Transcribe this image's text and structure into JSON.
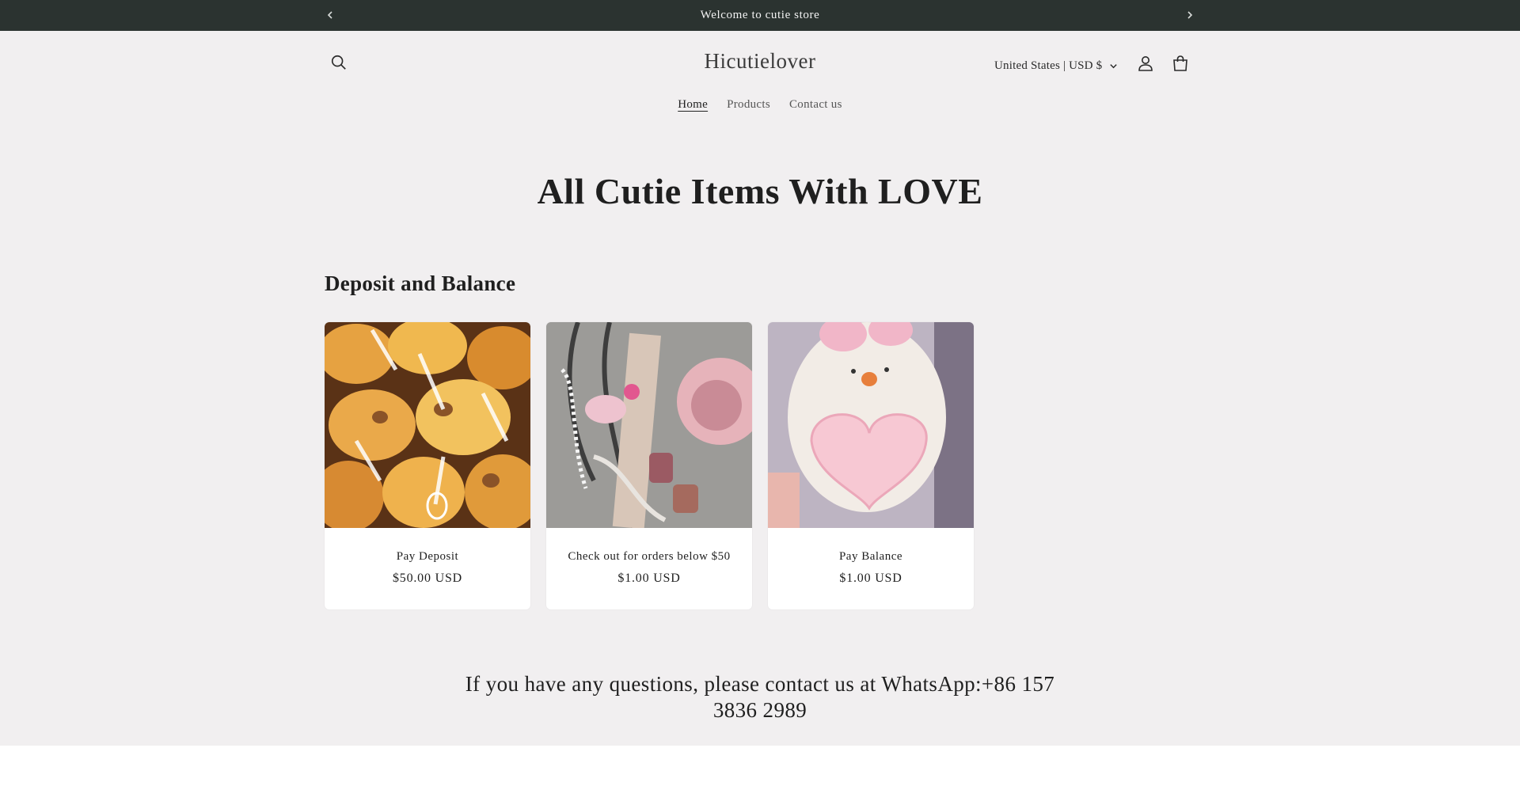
{
  "announcement": {
    "text": "Welcome to cutie store",
    "prev_icon": "chevron-left-icon",
    "next_icon": "chevron-right-icon",
    "background": "#2b3330"
  },
  "header": {
    "logo": "Hicutielover",
    "currency": "United States | USD $",
    "icons": [
      "search-icon",
      "account-icon",
      "cart-icon"
    ]
  },
  "nav": {
    "items": [
      {
        "label": "Home",
        "active": true
      },
      {
        "label": "Products",
        "active": false
      },
      {
        "label": "Contact us",
        "active": false
      }
    ]
  },
  "hero": {
    "title": "All Cutie Items With LOVE"
  },
  "collection": {
    "title": "Deposit and Balance",
    "products": [
      {
        "title": "Pay Deposit",
        "price": "$50.00 USD",
        "image": "orange-plush-toys-photo"
      },
      {
        "title": "Check out for orders below $50",
        "price": "$1.00 USD",
        "image": "pink-bag-charms-photo"
      },
      {
        "title": "Pay Balance",
        "price": "$1.00 USD",
        "image": "barbie-girl-bear-plush-photo"
      }
    ]
  },
  "contact": {
    "text": "If you have any questions, please contact us at WhatsApp:+86 157 3836 2989"
  },
  "colors": {
    "page_background": "#f1eff0",
    "card_background": "#ffffff",
    "text": "#1f1f1f"
  }
}
